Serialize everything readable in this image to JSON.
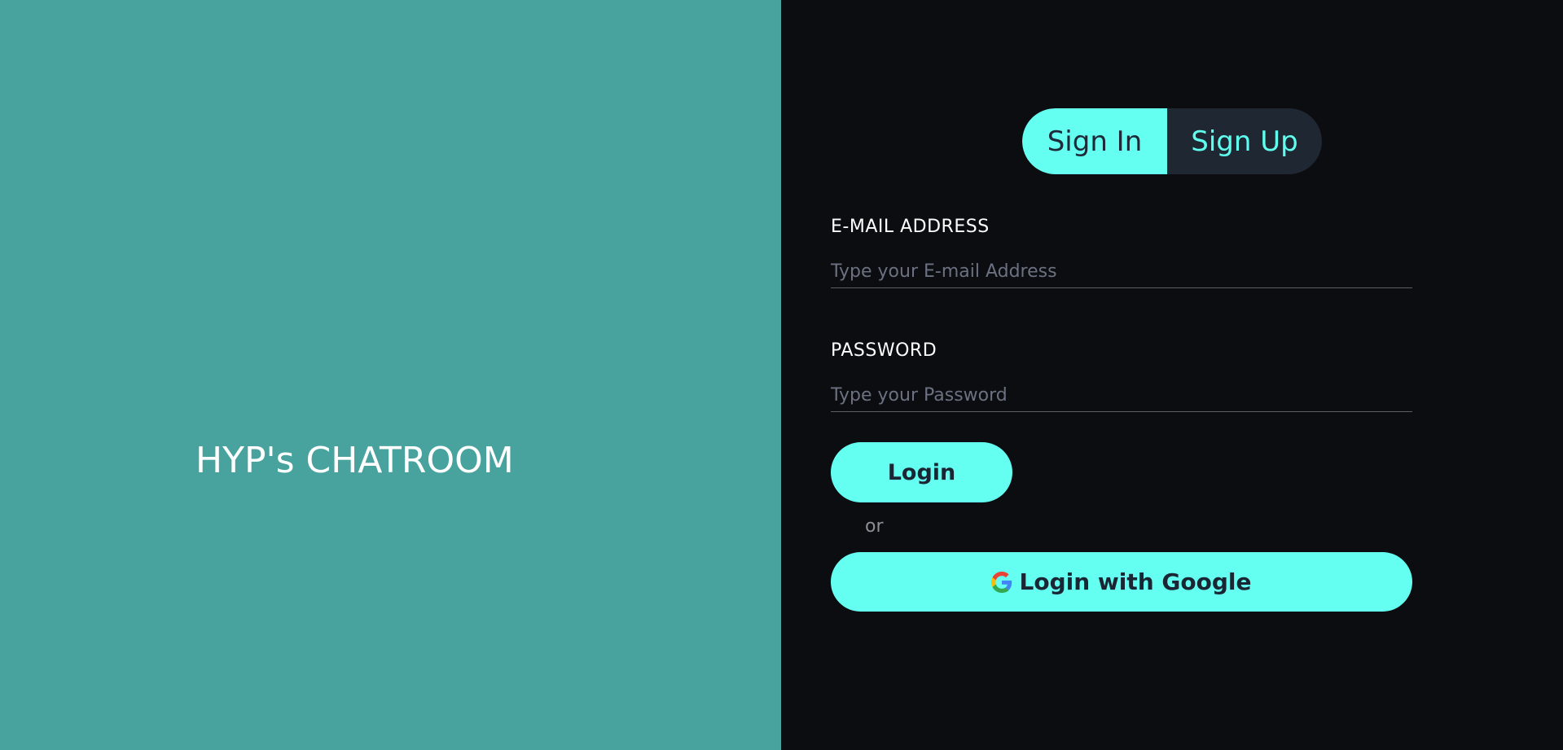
{
  "brand": {
    "title": "HYP's CHATROOM"
  },
  "auth_toggle": {
    "sign_in_label": "Sign In",
    "sign_up_label": "Sign Up",
    "active": "Sign In"
  },
  "email": {
    "label": "E-MAIL ADDRESS",
    "placeholder": "Type your E-mail Address",
    "value": ""
  },
  "password": {
    "label": "PASSWORD",
    "placeholder": "Type your Password",
    "value": ""
  },
  "login_button": {
    "label": "Login"
  },
  "divider_text": "or",
  "google_button": {
    "label": "Login with Google",
    "icon": "google-icon"
  },
  "colors": {
    "left_panel_bg": "#48a29e",
    "right_panel_bg": "#0b0d11",
    "accent": "#64fff0",
    "toggle_bg": "#1f2733"
  }
}
